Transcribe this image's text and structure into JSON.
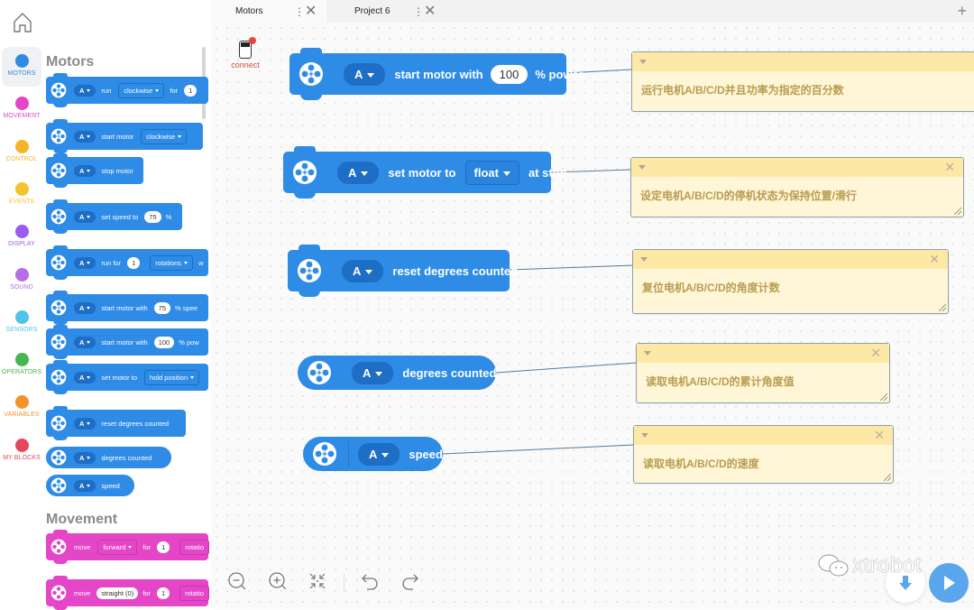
{
  "rail": {
    "home_icon": "home-icon",
    "categories": [
      {
        "label": "MOTORS",
        "color": "#2e8be6",
        "active": true
      },
      {
        "label": "MOVEMENT",
        "color": "#e545c7"
      },
      {
        "label": "CONTROL",
        "color": "#f3b52c"
      },
      {
        "label": "EVENTS",
        "color": "#f6c22e"
      },
      {
        "label": "DISPLAY",
        "color": "#9a5df0"
      },
      {
        "label": "SOUND",
        "color": "#b46ee8"
      },
      {
        "label": "SENSORS",
        "color": "#4fc3ea"
      },
      {
        "label": "OPERATORS",
        "color": "#47b54e"
      },
      {
        "label": "VARIABLES",
        "color": "#f5922b"
      },
      {
        "label": "MY BLOCKS",
        "color": "#e7475a"
      }
    ]
  },
  "palette": {
    "motors_heading": "Motors",
    "movement_heading": "Movement",
    "motors_blocks": [
      {
        "port": "A",
        "parts": [
          "run"
        ],
        "dropdown": "clockwise",
        "after": "for",
        "value": "1"
      },
      {
        "port": "A",
        "parts": [
          "start motor"
        ],
        "dropdown": "clockwise"
      },
      {
        "port": "A",
        "parts": [
          "stop motor"
        ]
      },
      {
        "port": "A",
        "parts": [
          "set speed to"
        ],
        "value": "75",
        "suffix": "%"
      },
      {
        "port": "A",
        "parts": [
          "run for"
        ],
        "value": "1",
        "dropdown": "rotations",
        "suffix": "w"
      },
      {
        "port": "A",
        "parts": [
          "start motor with"
        ],
        "value": "75",
        "suffix": "% spee"
      },
      {
        "port": "A",
        "parts": [
          "start motor with"
        ],
        "value": "100",
        "suffix": "% pow"
      },
      {
        "port": "A",
        "parts": [
          "set motor to"
        ],
        "dropdown": "hold position"
      },
      {
        "port": "A",
        "parts": [
          "reset degrees counted"
        ]
      },
      {
        "port": "A",
        "parts": [
          "degrees counted"
        ]
      },
      {
        "port": "A",
        "parts": [
          "speed"
        ]
      }
    ],
    "movement_blocks": [
      {
        "label": "move",
        "dropdown": "forward",
        "after": "for",
        "value": "1",
        "suffix": "rotatio"
      },
      {
        "label": "move",
        "pill": "straight (0)",
        "after": "for",
        "value": "1",
        "suffix": "rotatio"
      }
    ]
  },
  "tabs": [
    {
      "label": "Motors",
      "active": true
    },
    {
      "label": "Project 6",
      "active": false
    }
  ],
  "tab_add_icon": "plus-icon",
  "connect": {
    "label": "connect",
    "status_color": "#e8453c"
  },
  "canvas": {
    "blocks": [
      {
        "port": "A",
        "text1": "start motor with",
        "value": "100",
        "text2": "% power"
      },
      {
        "port": "A",
        "text1": "set motor to",
        "dropdown": "float",
        "text2": "at stop"
      },
      {
        "port": "A",
        "text1": "reset degrees counted"
      },
      {
        "port": "A",
        "text1": "degrees counted"
      },
      {
        "port": "A",
        "text1": "speed"
      }
    ],
    "comments": [
      {
        "text": "运行电机A/B/C/D并且功率为指定的百分数"
      },
      {
        "text": "设定电机A/B/C/D的停机状态为保持位置/滑行"
      },
      {
        "text": "复位电机A/B/C/D的角度计数"
      },
      {
        "text": "读取电机A/B/C/D的累计角度值"
      },
      {
        "text": "读取电机A/B/C/D的速度"
      }
    ]
  },
  "toolbar": {
    "zoom_out": "zoom-out-icon",
    "zoom_in": "zoom-in-icon",
    "reset_zoom": "fit-icon",
    "undo": "undo-icon",
    "redo": "redo-icon"
  },
  "watermark": "xtrobot",
  "colors": {
    "motor_block": "#2e8be6",
    "movement_block": "#e545c7",
    "comment_bg": "#fef6d6",
    "comment_bar": "#fde9a5",
    "run_button": "#5aa6ec"
  }
}
